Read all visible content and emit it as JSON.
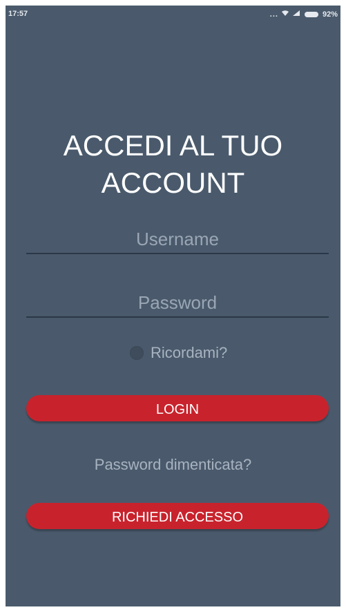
{
  "status_bar": {
    "time": "17:57",
    "dots": "...",
    "battery_percent": "92%",
    "icons": [
      "wifi-icon",
      "signal-icon",
      "battery-icon"
    ]
  },
  "login": {
    "title_line1": "ACCEDI AL TUO",
    "title_line2": "ACCOUNT",
    "username_placeholder": "Username",
    "password_placeholder": "Password",
    "remember_label": "Ricordami?",
    "login_button": "LOGIN",
    "forgot_link": "Password dimenticata?",
    "request_button": "RICHIEDI ACCESSO"
  },
  "colors": {
    "background": "#4a5a6c",
    "accent": "#c8232d",
    "text_primary": "#ffffff",
    "text_muted": "#a8b3c0"
  }
}
